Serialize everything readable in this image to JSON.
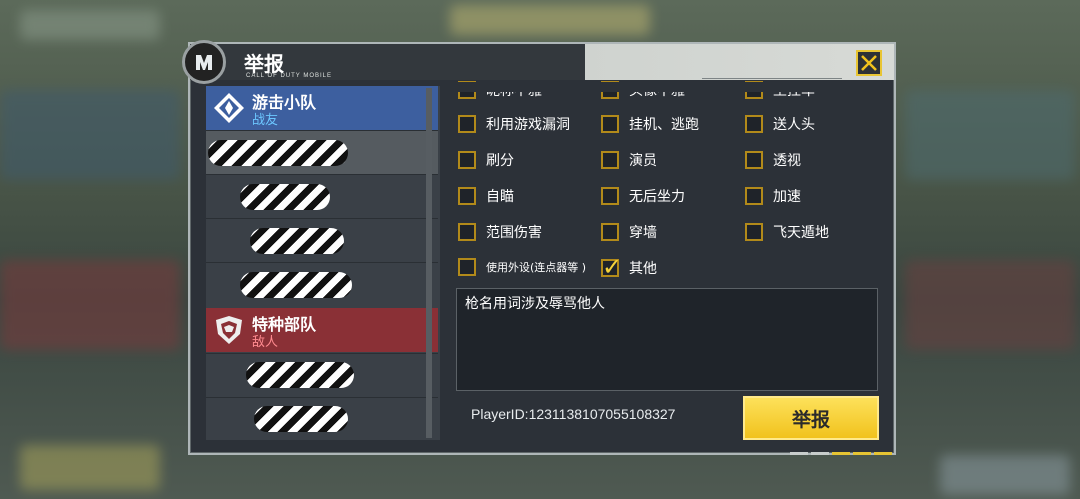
{
  "dialog": {
    "title": "举报",
    "subtitle": "CALL OF DUTY MOBILE",
    "close_icon": "close-x-icon",
    "accent": "#f1c21d"
  },
  "teams": [
    {
      "name": "游击小队",
      "role": "战友",
      "color": "#3d5f9f",
      "emblem": "guerrilla-emblem-icon"
    },
    {
      "name": "特种部队",
      "role": "敌人",
      "color": "#8a3036",
      "emblem": "special-forces-emblem-icon"
    }
  ],
  "options": [
    {
      "label": "昵称不雅",
      "checked": false
    },
    {
      "label": "头像不雅",
      "checked": false
    },
    {
      "label": "坐挂车",
      "checked": false
    },
    {
      "label": "利用游戏漏洞",
      "checked": false
    },
    {
      "label": "挂机、逃跑",
      "checked": false
    },
    {
      "label": "送人头",
      "checked": false
    },
    {
      "label": "刷分",
      "checked": false
    },
    {
      "label": "演员",
      "checked": false
    },
    {
      "label": "透视",
      "checked": false
    },
    {
      "label": "自瞄",
      "checked": false
    },
    {
      "label": "无后坐力",
      "checked": false
    },
    {
      "label": "加速",
      "checked": false
    },
    {
      "label": "范围伤害",
      "checked": false
    },
    {
      "label": "穿墙",
      "checked": false
    },
    {
      "label": "飞天遁地",
      "checked": false
    },
    {
      "label": "使用外设(连点器等 )",
      "checked": false
    },
    {
      "label": "其他",
      "checked": true
    }
  ],
  "description": "枪名用词涉及辱骂他人",
  "player_id": "PlayerID:1231138107055108327",
  "submit_label": "举报"
}
